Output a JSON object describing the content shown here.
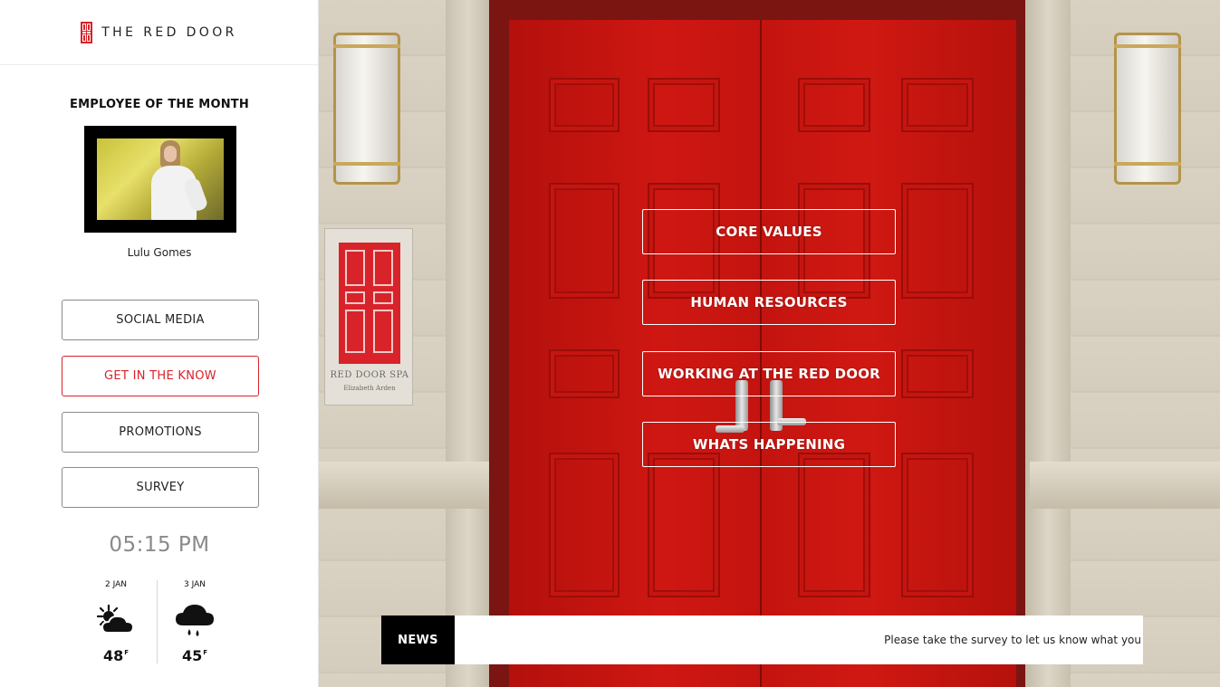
{
  "brand": {
    "name": "THE RED DOOR"
  },
  "employee_of_month": {
    "title": "EMPLOYEE OF THE MONTH",
    "name": "Lulu Gomes"
  },
  "sidebar_nav": {
    "items": [
      {
        "label": "SOCIAL MEDIA",
        "active": false
      },
      {
        "label": "GET IN THE KNOW",
        "active": true
      },
      {
        "label": "PROMOTIONS",
        "active": false
      },
      {
        "label": "SURVEY",
        "active": false
      }
    ]
  },
  "clock": {
    "time": "05:15 PM"
  },
  "weather": [
    {
      "date": "2 JAN",
      "icon": "partly-cloudy-sun-icon",
      "temp": "48",
      "unit": "F"
    },
    {
      "date": "3 JAN",
      "icon": "rain-cloud-icon",
      "temp": "45",
      "unit": "F"
    }
  ],
  "sign": {
    "title": "RED DOOR SPA",
    "subtitle": "Elizabeth Arden"
  },
  "main_menu": {
    "items": [
      {
        "label": "CORE VALUES"
      },
      {
        "label": "HUMAN RESOURCES"
      },
      {
        "label": "WORKING AT THE RED DOOR"
      },
      {
        "label": "WHATS HAPPENING"
      }
    ]
  },
  "news": {
    "label": "NEWS",
    "text": "Please take the survey to let us know what you"
  },
  "colors": {
    "accent": "#d8232a",
    "door": "#c4140f"
  }
}
